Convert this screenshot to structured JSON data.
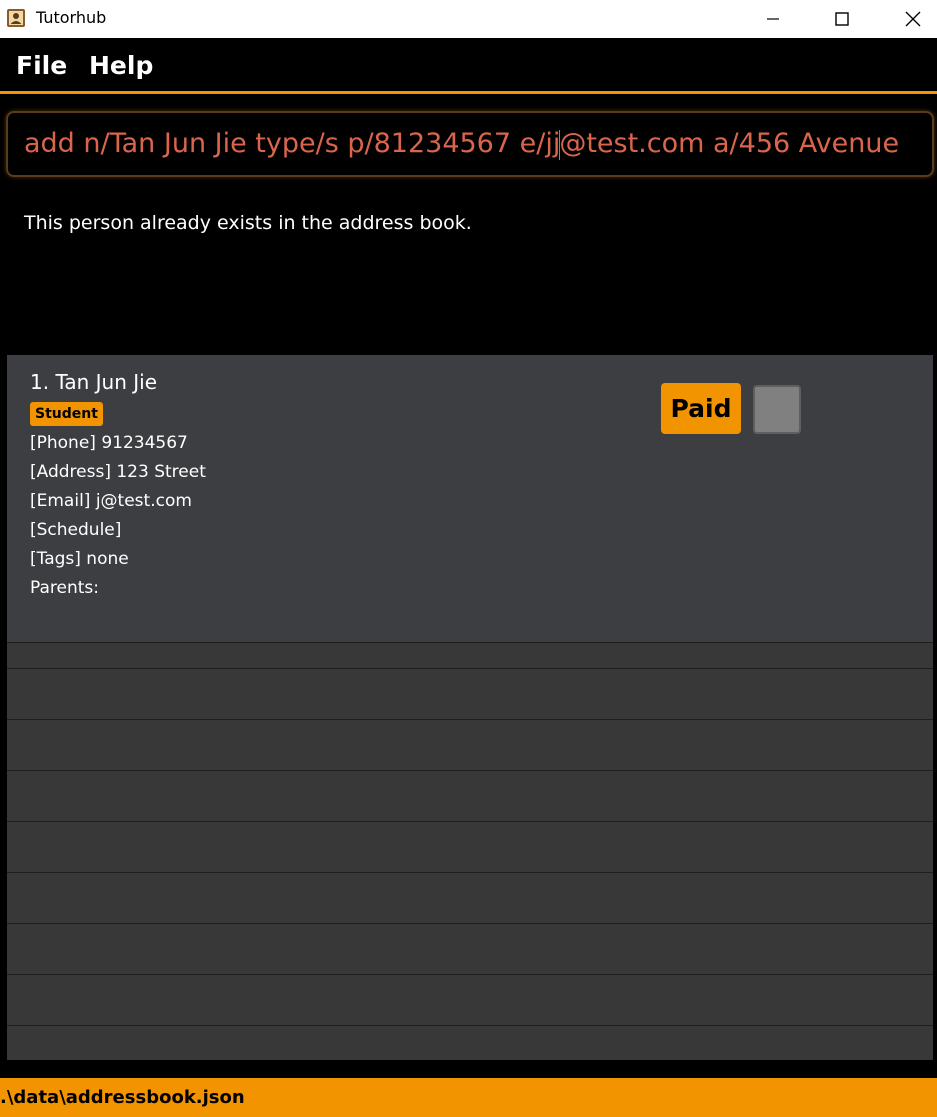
{
  "window": {
    "title": "Tutorhub",
    "icon": "contact-book-icon"
  },
  "menu": {
    "file_label": "File",
    "help_label": "Help"
  },
  "command_box": {
    "value_before_caret": "add n/Tan Jun Jie type/s p/81234567 e/jj",
    "value_after_caret": "@test.com a/456 Avenue"
  },
  "result_display": {
    "message": "This person already exists in the address book."
  },
  "person_list": {
    "persons": [
      {
        "name": "1. Tan Jun Jie",
        "type": "Student",
        "phone": "[Phone] 91234567",
        "address": "[Address] 123 Street",
        "email": "[Email] j@test.com",
        "schedule": "[Schedule]",
        "tags": "[Tags] none",
        "parents": "Parents:",
        "paid_label": "Paid",
        "paid_checked": false
      }
    ]
  },
  "status_bar": {
    "save_location": ".\\data\\addressbook.json"
  },
  "colors": {
    "accent": "#f29400",
    "command_text": "#d9654d",
    "card_background": "#3c3e41",
    "list_background": "#383838"
  }
}
